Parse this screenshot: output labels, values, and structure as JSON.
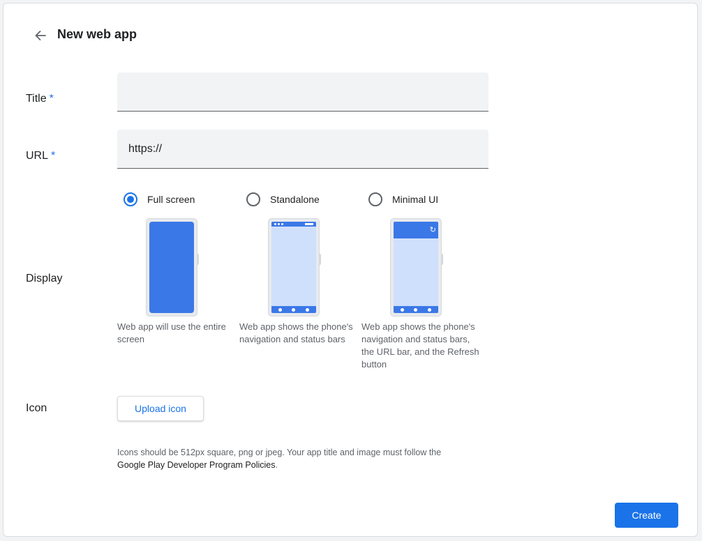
{
  "header": {
    "title": "New web app",
    "back_icon": "arrow-left-icon"
  },
  "form": {
    "title_label": "Title",
    "url_label": "URL",
    "required_mark": "*",
    "title_value": "",
    "url_value": "https://",
    "display_label": "Display",
    "icon_label": "Icon"
  },
  "display_options": [
    {
      "label": "Full screen",
      "selected": true,
      "description": "Web app will use the entire screen"
    },
    {
      "label": "Standalone",
      "selected": false,
      "description": "Web app shows the phone's navigation and status bars"
    },
    {
      "label": "Minimal UI",
      "selected": false,
      "description": "Web app shows the phone's navigation and status bars, the URL bar, and the Refresh button"
    }
  ],
  "upload": {
    "label": "Upload icon"
  },
  "helper": {
    "text": "Icons should be 512px square, png or jpeg. Your app title and image must follow the",
    "link": "Google Play Developer Program Policies",
    "suffix": "."
  },
  "actions": {
    "create_label": "Create"
  },
  "colors": {
    "accent": "#1a73e8",
    "phone_screen": "#3b78e7",
    "phone_screen_light": "#cfe0fc"
  }
}
